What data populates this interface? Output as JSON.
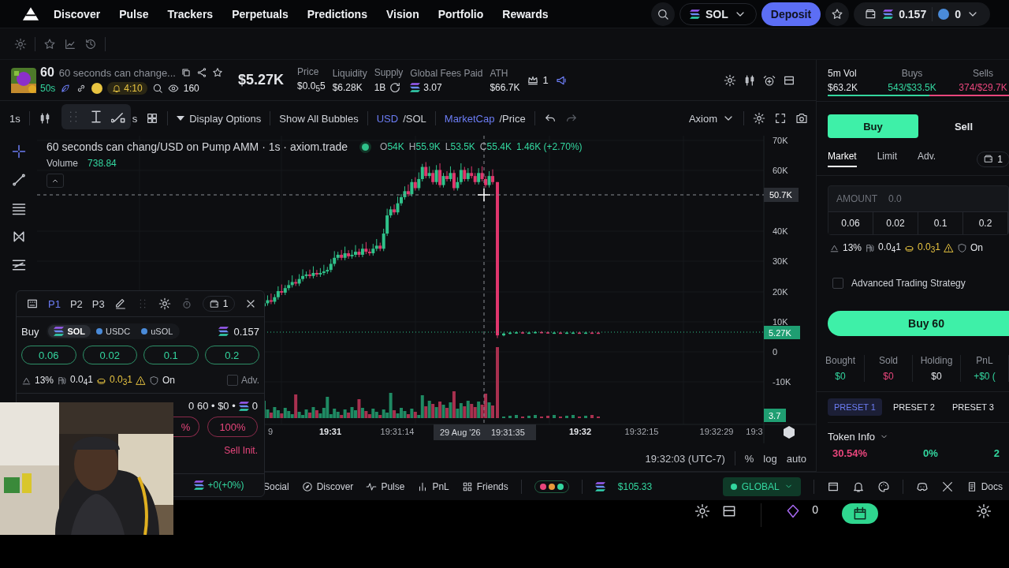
{
  "nav": {
    "links": [
      "Discover",
      "Pulse",
      "Trackers",
      "Perpetuals",
      "Predictions",
      "Vision",
      "Portfolio",
      "Rewards"
    ],
    "currency": "SOL",
    "deposit": "Deposit",
    "wallet_balance": "0.157",
    "wallet_points": "0"
  },
  "token": {
    "ticker": "60",
    "name": "60 seconds can change...",
    "age": "50s",
    "timer": "4:10",
    "watchers": "160",
    "market_cap": "$5.27K",
    "stats": [
      {
        "label": "Price",
        "value": "$0.0$_{5}$5"
      },
      {
        "label": "Liquidity",
        "value": "$6.28K"
      },
      {
        "label": "Supply",
        "value": "1B"
      },
      {
        "label": "Global Fees Paid",
        "value": "3.07"
      },
      {
        "label": "ATH",
        "value": "$66.7K"
      }
    ],
    "top_holders": "1"
  },
  "flow": {
    "vol_label": "5m Vol",
    "vol": "$63.2K",
    "buys_label": "Buys",
    "buys_count": "543",
    "buys_value": "/$33.5K",
    "sells_label": "Sells",
    "sells_count": "374",
    "sells_value": "/$29.7K",
    "level": 0.56
  },
  "chart_toolbar": {
    "interval": "1s",
    "hidden_label": "s",
    "display_options": "Display Options",
    "bubbles": "Show All Bubbles",
    "currency_a": "USD",
    "currency_b": "/SOL",
    "mode_a": "MarketCap",
    "mode_b": "/Price",
    "theme": "Axiom"
  },
  "chart": {
    "title": "60 seconds can chang/USD on Pump AMM · 1s · axiom.trade",
    "ohlc": [
      {
        "key": "O",
        "value": "54K"
      },
      {
        "key": "H",
        "value": "55.9K"
      },
      {
        "key": "L",
        "value": "53.5K"
      },
      {
        "key": "C",
        "value": "55.4K"
      }
    ],
    "change": "1.46K (+2.70%)",
    "volume_label": "Volume",
    "volume": "738.84",
    "y_labels": [
      "70K",
      "60K",
      "40K",
      "30K",
      "20K",
      "10K",
      "0",
      "-10K"
    ],
    "crosshair_price": "50.7K",
    "last_price": "5.27K",
    "last_volume": "3.7",
    "x_labels": [
      {
        "label": "9",
        "major": false
      },
      {
        "label": "19:31",
        "major": true
      },
      {
        "label": "19:31:14",
        "major": false
      },
      {
        "label": "19:32",
        "major": true
      },
      {
        "label": "19:32:15",
        "major": false
      },
      {
        "label": "19:32:29",
        "major": false
      },
      {
        "label": "19:3",
        "major": false
      }
    ],
    "crosshair_date": "29 Aug '26",
    "crosshair_time": "19:31:35",
    "time": "19:32:03 (UTC-7)",
    "scale_buttons": [
      "%",
      "log",
      "auto"
    ]
  },
  "float_panel": {
    "presets": [
      {
        "label": "P1",
        "selected": true
      },
      {
        "label": "P2",
        "selected": false
      },
      {
        "label": "P3",
        "selected": false
      }
    ],
    "wallets": "1",
    "side": "Buy",
    "tokens": [
      {
        "label": "SOL",
        "selected": true
      },
      {
        "label": "USDC",
        "selected": false
      },
      {
        "label": "uSOL",
        "selected": false
      }
    ],
    "balance": "0.157",
    "amounts": [
      "0.06",
      "0.02",
      "0.1",
      "0.2"
    ],
    "slippage": "13%",
    "priority": "0.0$_{4}$1",
    "bribe": "0.0$_{3}$1",
    "mev": "On",
    "adv_label": "Adv.",
    "adv_checked": false,
    "position": "0 60 • $0 •",
    "position_sol": "0",
    "sell_percents": [
      "%",
      "100%"
    ],
    "sell_init": "Sell Init.",
    "pnl": "+0(+0%)"
  },
  "trade_panel": {
    "sides": [
      {
        "label": "Buy",
        "selected": true
      },
      {
        "label": "Sell",
        "selected": false
      }
    ],
    "order_types": [
      {
        "label": "Market",
        "selected": true
      },
      {
        "label": "Limit",
        "selected": false
      },
      {
        "label": "Adv.",
        "selected": false
      }
    ],
    "wallets": "1",
    "amount_label": "AMOUNT",
    "amount_placeholder": "0.0",
    "amounts": [
      "0.06",
      "0.02",
      "0.1",
      "0.2"
    ],
    "slippage": "13%",
    "priority": "0.0$_{4}$1",
    "bribe": "0.0$_{3}$1",
    "mev": "On",
    "strategy_label": "Advanced Trading Strategy",
    "strategy_checked": false,
    "buy_button": "Buy 60",
    "position": [
      {
        "label": "Bought",
        "value": "$0",
        "color": "#33d69f"
      },
      {
        "label": "Sold",
        "value": "$0",
        "color": "#e8467c"
      },
      {
        "label": "Holding",
        "value": "$0",
        "color": "#e4e6ea"
      },
      {
        "label": "PnL",
        "value": "+$0 (",
        "color": "#33d69f"
      }
    ],
    "presets": [
      {
        "label": "PRESET 1",
        "selected": true
      },
      {
        "label": "PRESET 2",
        "selected": false
      },
      {
        "label": "PRESET 3",
        "selected": false
      }
    ],
    "token_info": "Token Info",
    "info": [
      {
        "value": "30.54%",
        "color": "#e8467c"
      },
      {
        "value": "0%",
        "color": "#33d69f"
      },
      {
        "value": "2",
        "color": "#33d69f"
      }
    ]
  },
  "status_bar": {
    "links": [
      "Social",
      "Discover",
      "Pulse",
      "PnL",
      "Friends"
    ],
    "sol_price": "$105.33",
    "region": "GLOBAL",
    "docs": "Docs"
  },
  "lower_strip": {
    "points": "0"
  }
}
